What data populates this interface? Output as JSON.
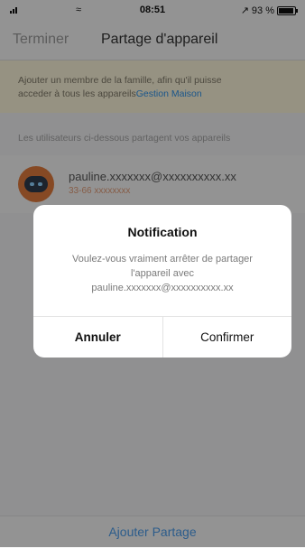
{
  "status_bar": {
    "time": "08:51",
    "battery": "93 %",
    "battery_level": 0.93,
    "location_glyph": "↗"
  },
  "navbar": {
    "back_label": "Terminer",
    "title": "Partage d'appareil"
  },
  "banner": {
    "text_line1": "Ajouter un membre de la famille, afin qu'il puisse",
    "text_line2": "acceder à tous les appareils",
    "link_label": "Gestion Maison"
  },
  "section_label": "Les utilisateurs ci-dessous partagent vos appareils",
  "user": {
    "email": "pauline.xxxxxxx@xxxxxxxxxx.xx",
    "phone": "33-66 xxxxxxxx",
    "avatar_icon": "robot-avatar-icon"
  },
  "bottom_button_label": "Ajouter Partage",
  "alert": {
    "title": "Notification",
    "message_line1": "Voulez-vous vraiment arrêter de partager",
    "message_line2": "l'appareil avec",
    "message_line3": "pauline.xxxxxxx@xxxxxxxxxx.xx",
    "cancel_label": "Annuler",
    "confirm_label": "Confirmer"
  },
  "colors": {
    "accent": "#2e90e6",
    "banner_background": "#fbf3d9",
    "avatar": "#e07a3d"
  }
}
